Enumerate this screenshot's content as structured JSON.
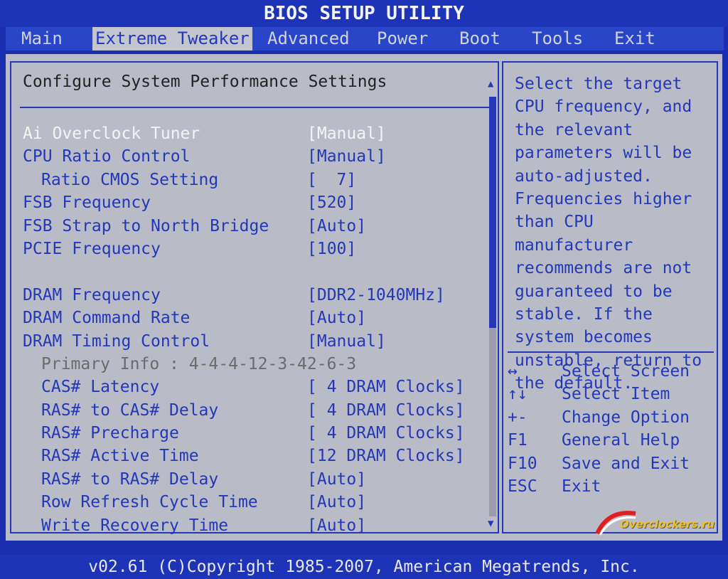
{
  "window": {
    "title": "BIOS SETUP UTILITY"
  },
  "menu": {
    "items": [
      {
        "label": "Main"
      },
      {
        "label": "Extreme Tweaker",
        "active": true
      },
      {
        "label": "Advanced"
      },
      {
        "label": "Power"
      },
      {
        "label": "Boot"
      },
      {
        "label": "Tools"
      },
      {
        "label": "Exit"
      }
    ]
  },
  "main": {
    "title": "Configure System Performance Settings",
    "rows": [
      {
        "label": "Ai Overclock Tuner",
        "value": "[Manual]"
      },
      {
        "label": "CPU Ratio Control",
        "value": "[Manual]"
      },
      {
        "label": "Ratio CMOS Setting",
        "value": "[  7]"
      },
      {
        "label": "FSB Frequency",
        "value": "[520]"
      },
      {
        "label": "FSB Strap to North Bridge",
        "value": "[Auto]"
      },
      {
        "label": "PCIE Frequency",
        "value": "[100]"
      },
      {
        "label": "DRAM Frequency",
        "value": "[DDR2-1040MHz]"
      },
      {
        "label": "DRAM Command Rate",
        "value": "[Auto]"
      },
      {
        "label": "DRAM Timing Control",
        "value": "[Manual]"
      },
      {
        "label": "Primary Info : 4-4-4-12-3-42-6-3",
        "value": ""
      },
      {
        "label": "CAS# Latency",
        "value": "[ 4 DRAM Clocks]"
      },
      {
        "label": "RAS# to CAS# Delay",
        "value": "[ 4 DRAM Clocks]"
      },
      {
        "label": "RAS# Precharge",
        "value": "[ 4 DRAM Clocks]"
      },
      {
        "label": "RAS# Active Time",
        "value": "[12 DRAM Clocks]"
      },
      {
        "label": "RAS# to RAS# Delay",
        "value": "[Auto]"
      },
      {
        "label": "Row Refresh Cycle Time",
        "value": "[Auto]"
      },
      {
        "label": "Write Recovery Time",
        "value": "[Auto]"
      }
    ],
    "scroll": {
      "position_fraction": 0.55
    }
  },
  "help": {
    "text": "Select the target CPU frequency, and the relevant parameters will be auto-adjusted. Frequencies higher than CPU manufacturer recommends are not guaranteed to be stable. If the system becomes unstable, return to the default.",
    "keys": [
      {
        "key": "↔",
        "desc": "Select Screen"
      },
      {
        "key": "↑↓",
        "desc": "Select Item"
      },
      {
        "key": "+-",
        "desc": "Change Option"
      },
      {
        "key": "F1",
        "desc": "General Help"
      },
      {
        "key": "F10",
        "desc": "Save and Exit"
      },
      {
        "key": "ESC",
        "desc": "Exit"
      }
    ]
  },
  "footer": {
    "text": "v02.61 (C)Copyright 1985-2007, American Megatrends, Inc."
  },
  "watermark": {
    "text": "Overclockers.ru"
  },
  "colors": {
    "background": "#1a2fb0",
    "panel": "#b9bcc6",
    "text_blue": "#2238b8",
    "selected_text": "#f4f4f4"
  }
}
